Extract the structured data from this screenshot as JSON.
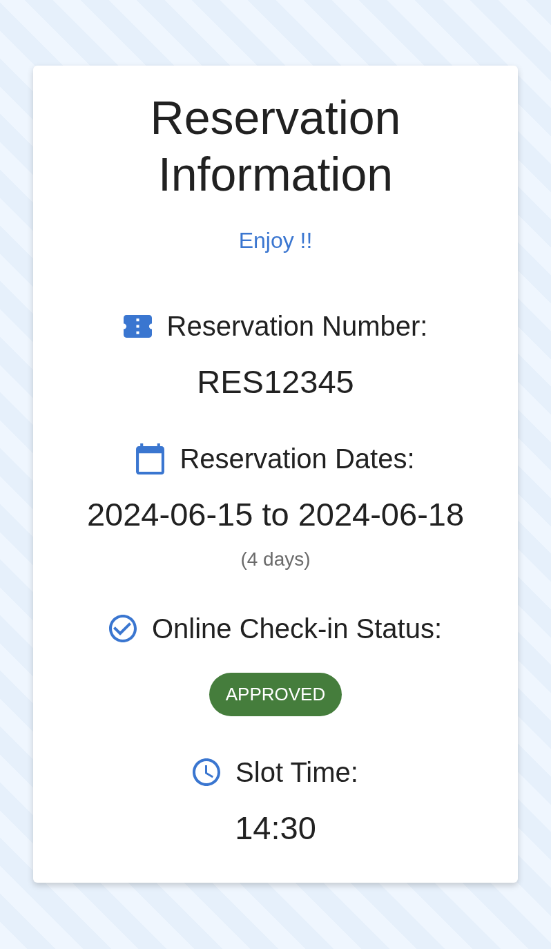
{
  "card": {
    "title": "Reservation Information",
    "subtitle": "Enjoy !!",
    "reservation_number": {
      "label": "Reservation Number:",
      "value": "RES12345"
    },
    "reservation_dates": {
      "label": "Reservation Dates:",
      "value": "2024-06-15 to 2024-06-18",
      "duration": "(4 days)"
    },
    "check_in_status": {
      "label": "Online Check-in Status:",
      "status": "APPROVED"
    },
    "slot_time": {
      "label": "Slot Time:",
      "value": "14:30"
    }
  }
}
